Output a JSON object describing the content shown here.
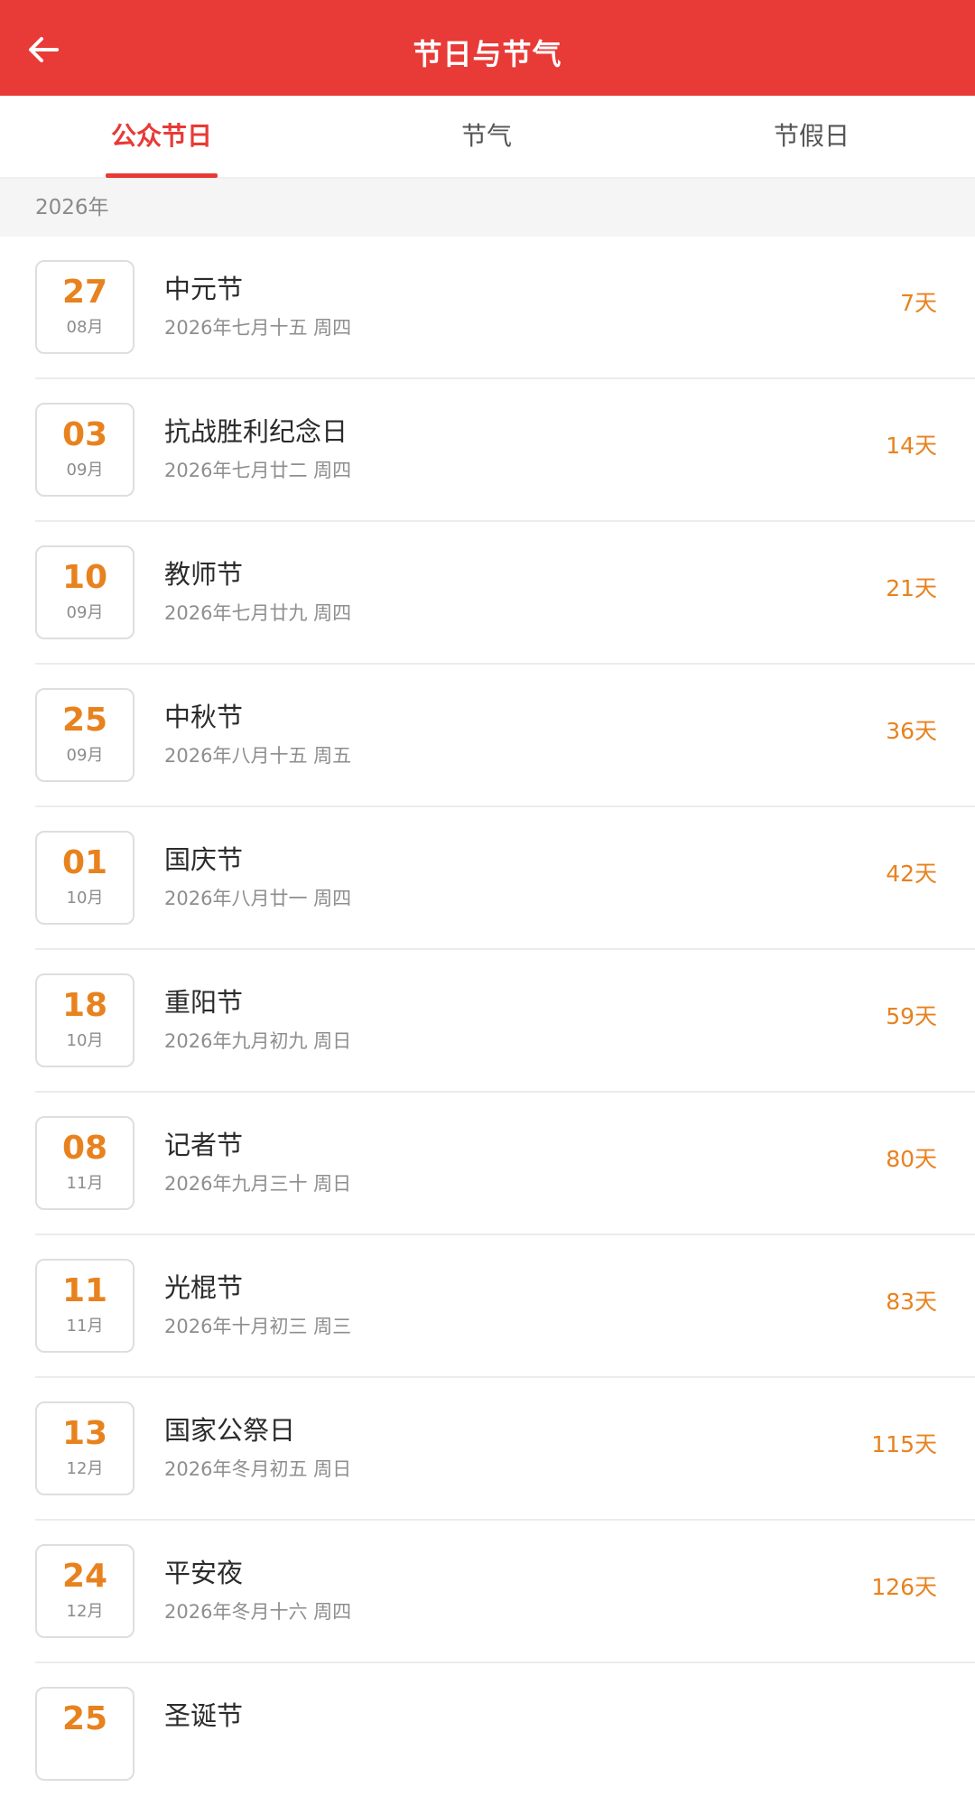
{
  "header": {
    "title": "节日与节气",
    "back_icon": "arrow-left-icon"
  },
  "tabs": [
    {
      "label": "公众节日",
      "active": true
    },
    {
      "label": "节气",
      "active": false
    },
    {
      "label": "节假日",
      "active": false
    }
  ],
  "section": {
    "year": "2026年"
  },
  "colors": {
    "header_bg": "#e83a37",
    "accent": "#e8821e",
    "active_tab": "#e83a37"
  },
  "festivals": [
    {
      "day": "27",
      "month": "08月",
      "name": "中元节",
      "sub": "2026年七月十五 周四",
      "days": "7天"
    },
    {
      "day": "03",
      "month": "09月",
      "name": "抗战胜利纪念日",
      "sub": "2026年七月廿二 周四",
      "days": "14天"
    },
    {
      "day": "10",
      "month": "09月",
      "name": "教师节",
      "sub": "2026年七月廿九 周四",
      "days": "21天"
    },
    {
      "day": "25",
      "month": "09月",
      "name": "中秋节",
      "sub": "2026年八月十五 周五",
      "days": "36天"
    },
    {
      "day": "01",
      "month": "10月",
      "name": "国庆节",
      "sub": "2026年八月廿一 周四",
      "days": "42天"
    },
    {
      "day": "18",
      "month": "10月",
      "name": "重阳节",
      "sub": "2026年九月初九 周日",
      "days": "59天"
    },
    {
      "day": "08",
      "month": "11月",
      "name": "记者节",
      "sub": "2026年九月三十 周日",
      "days": "80天"
    },
    {
      "day": "11",
      "month": "11月",
      "name": "光棍节",
      "sub": "2026年十月初三 周三",
      "days": "83天"
    },
    {
      "day": "13",
      "month": "12月",
      "name": "国家公祭日",
      "sub": "2026年冬月初五 周日",
      "days": "115天"
    },
    {
      "day": "24",
      "month": "12月",
      "name": "平安夜",
      "sub": "2026年冬月十六 周四",
      "days": "126天"
    },
    {
      "day": "25",
      "month": "",
      "name": "圣诞节",
      "sub": "",
      "days": ""
    }
  ]
}
